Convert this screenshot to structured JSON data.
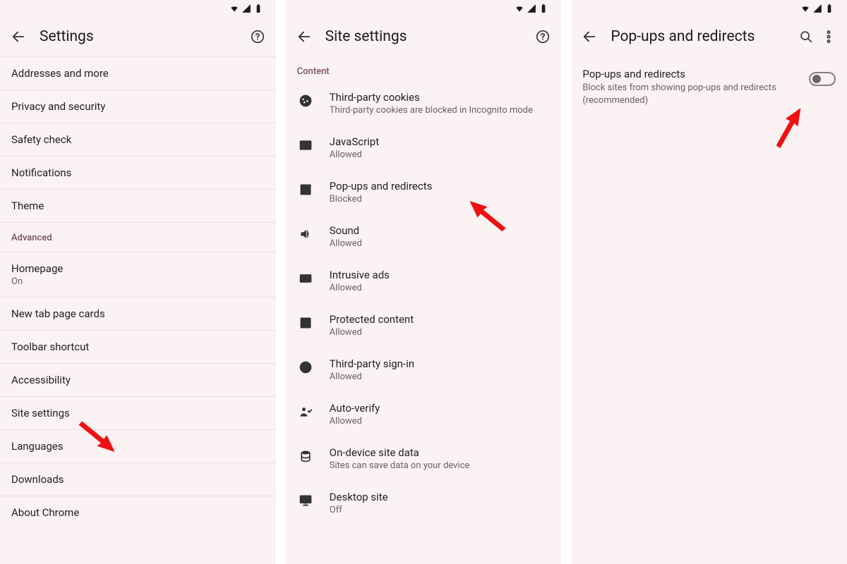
{
  "panel1": {
    "title": "Settings",
    "advanced_label": "Advanced",
    "items_top": [
      {
        "label": "Addresses and more"
      },
      {
        "label": "Privacy and security"
      },
      {
        "label": "Safety check"
      },
      {
        "label": "Notifications"
      },
      {
        "label": "Theme"
      }
    ],
    "items_adv": [
      {
        "label": "Homepage",
        "sub": "On"
      },
      {
        "label": "New tab page cards"
      },
      {
        "label": "Toolbar shortcut"
      },
      {
        "label": "Accessibility"
      },
      {
        "label": "Site settings"
      },
      {
        "label": "Languages"
      },
      {
        "label": "Downloads"
      },
      {
        "label": "About Chrome"
      }
    ]
  },
  "panel2": {
    "title": "Site settings",
    "section": "Content",
    "items": [
      {
        "icon": "cookie-icon",
        "label": "Third-party cookies",
        "sub": "Third-party cookies are blocked in Incognito mode"
      },
      {
        "icon": "javascript-icon",
        "label": "JavaScript",
        "sub": "Allowed"
      },
      {
        "icon": "open-new-icon",
        "label": "Pop-ups and redirects",
        "sub": "Blocked"
      },
      {
        "icon": "speaker-icon",
        "label": "Sound",
        "sub": "Allowed"
      },
      {
        "icon": "rectangle-icon",
        "label": "Intrusive ads",
        "sub": "Allowed"
      },
      {
        "icon": "check-box-icon",
        "label": "Protected content",
        "sub": "Allowed"
      },
      {
        "icon": "person-circle-icon",
        "label": "Third-party sign-in",
        "sub": "Allowed"
      },
      {
        "icon": "person-check-icon",
        "label": "Auto-verify",
        "sub": "Allowed"
      },
      {
        "icon": "stack-icon",
        "label": "On-device site data",
        "sub": "Sites can save data on your device"
      },
      {
        "icon": "monitor-icon",
        "label": "Desktop site",
        "sub": "Off"
      }
    ]
  },
  "panel3": {
    "title": "Pop-ups and redirects",
    "row": {
      "label": "Pop-ups and redirects",
      "sub": "Block sites from showing pop-ups and redirects (recommended)"
    },
    "toggle_on": false
  }
}
